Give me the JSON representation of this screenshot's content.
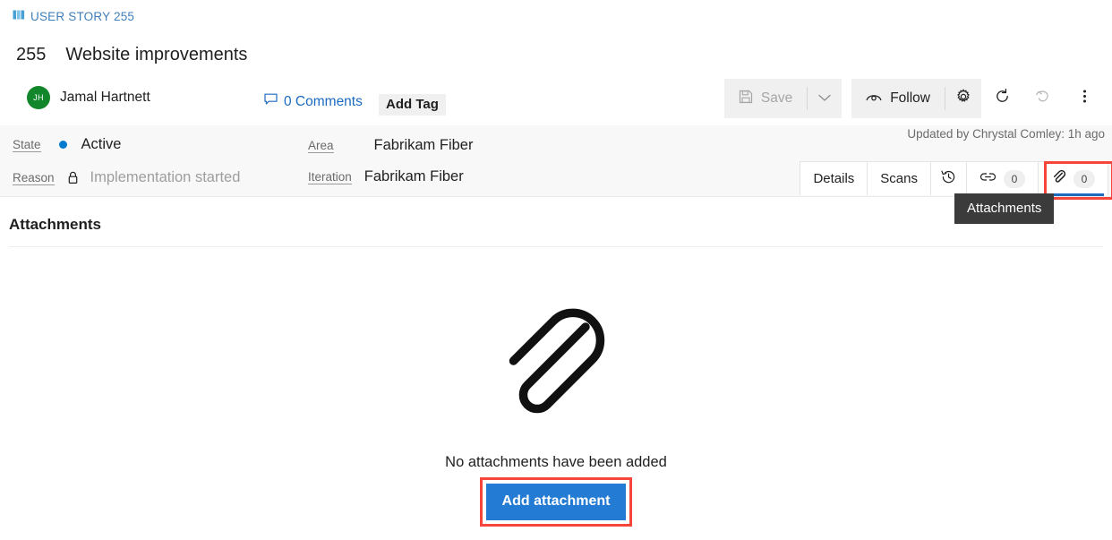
{
  "window": {
    "restore_icon": "restore-down-icon",
    "close_icon": "close-icon"
  },
  "header": {
    "work_item_type_icon": "user-story-icon",
    "work_item_type": "USER STORY 255",
    "id": "255",
    "title": "Website improvements",
    "avatar_initials": "JH",
    "assigned_to": "Jamal Hartnett",
    "comments_icon": "comment-icon",
    "comments_label": "0 Comments",
    "add_tag_label": "Add Tag"
  },
  "toolbar": {
    "save_icon": "save-disk-icon",
    "save_label": "Save",
    "save_caret_icon": "chevron-down-icon",
    "follow_icon": "eye-icon",
    "follow_label": "Follow",
    "settings_icon": "gear-icon",
    "refresh_icon": "refresh-icon",
    "undo_icon": "undo-icon",
    "more_icon": "more-vertical-icon"
  },
  "fields": {
    "state_label": "State",
    "state_value": "Active",
    "state_color": "#007acc",
    "reason_label": "Reason",
    "reason_icon": "lock-icon",
    "reason_value": "Implementation started",
    "area_label": "Area",
    "area_value": "Fabrikam Fiber",
    "iteration_label": "Iteration",
    "iteration_value": "Fabrikam Fiber",
    "updated_note": "Updated by Chrystal Comley: 1h ago"
  },
  "tabs": [
    {
      "label": "Details",
      "icon": null,
      "count": null,
      "selected": false
    },
    {
      "label": "Scans",
      "icon": null,
      "count": null,
      "selected": false
    },
    {
      "label": "",
      "icon": "history-icon",
      "count": null,
      "selected": false
    },
    {
      "label": "",
      "icon": "link-icon",
      "count": "0",
      "selected": false
    },
    {
      "label": "",
      "icon": "paperclip-icon",
      "count": "0",
      "selected": true
    }
  ],
  "tooltip": {
    "text": "Attachments"
  },
  "content": {
    "section_title": "Attachments",
    "empty_icon": "paperclip-large-icon",
    "empty_text": "No attachments have been added",
    "add_button_label": "Add attachment"
  },
  "highlights": {
    "color": "#f6463c"
  }
}
